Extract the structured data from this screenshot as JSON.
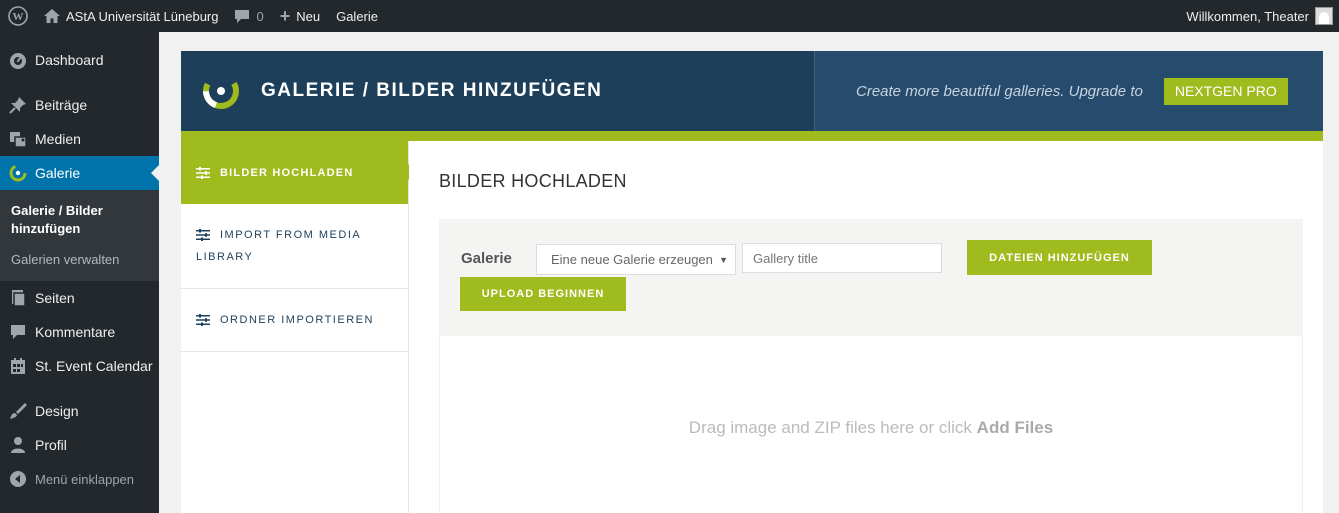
{
  "admin_bar": {
    "site_name": "AStA Universität Lüneburg",
    "comments_count": "0",
    "new_label": "Neu",
    "gallery_label": "Galerie",
    "welcome": "Willkommen, Theater"
  },
  "sidebar": {
    "items": [
      {
        "label": "Dashboard",
        "icon": "dashboard-icon"
      },
      {
        "label": "Beiträge",
        "icon": "pin-icon"
      },
      {
        "label": "Medien",
        "icon": "media-icon"
      },
      {
        "label": "Galerie",
        "icon": "nextgen-icon"
      },
      {
        "label": "Seiten",
        "icon": "pages-icon"
      },
      {
        "label": "Kommentare",
        "icon": "comment-icon"
      },
      {
        "label": "St. Event Calendar",
        "icon": "calendar-icon"
      },
      {
        "label": "Design",
        "icon": "brush-icon"
      },
      {
        "label": "Profil",
        "icon": "user-icon"
      },
      {
        "label": "Menü einklappen",
        "icon": "collapse-icon"
      }
    ],
    "submenu": [
      {
        "label": "Galerie / Bilder hinzufügen"
      },
      {
        "label": "Galerien verwalten"
      }
    ]
  },
  "header": {
    "title": "GALERIE / BILDER HINZUFÜGEN",
    "promo_text": "Create more beautiful galleries. Upgrade to",
    "promo_button": "NEXTGEN PRO"
  },
  "tabs": [
    {
      "label": "BILDER HOCHLADEN"
    },
    {
      "label": "IMPORT FROM MEDIA LIBRARY"
    },
    {
      "label": "ORDNER IMPORTIEREN"
    }
  ],
  "content": {
    "title": "BILDER HOCHLADEN",
    "gallery_label": "Galerie",
    "select_value": "Eine neue Galerie erzeugen",
    "title_placeholder": "Gallery title",
    "add_files_button": "DATEIEN HINZUFÜGEN",
    "upload_button": "UPLOAD BEGINNEN",
    "drop_text": "Drag image and ZIP files here or click",
    "drop_link": "Add Files"
  },
  "colors": {
    "accent_green": "#9fbb1d",
    "header_navy": "#1e3f5a",
    "wp_dark": "#23282d",
    "wp_blue": "#0073aa"
  }
}
